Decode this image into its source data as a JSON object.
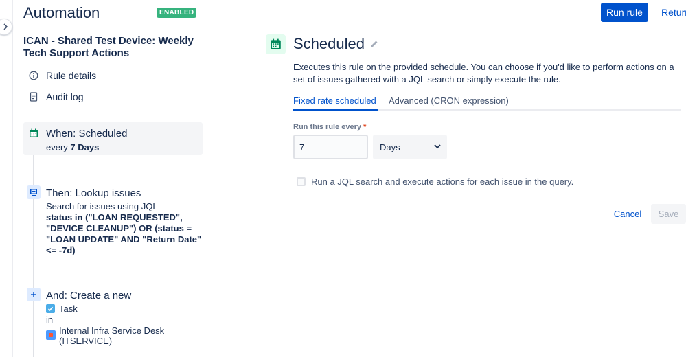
{
  "header": {
    "app_title": "Automation",
    "status": "ENABLED",
    "run_rule_label": "Run rule",
    "return_label": "Return"
  },
  "sidebar": {
    "rule_name": "ICAN - Shared Test Device: Weekly Tech Support Actions",
    "nav": [
      {
        "label": "Rule details",
        "icon": "info-icon"
      },
      {
        "label": "Audit log",
        "icon": "document-icon"
      }
    ],
    "steps": {
      "trigger": {
        "title": "When: Scheduled",
        "sub_prefix": "every ",
        "sub_value": "7 Days",
        "icon": "calendar-icon"
      },
      "lookup": {
        "title": "Then: Lookup issues",
        "sub": "Search for issues using JQL",
        "jql": "status in (\"LOAN REQUESTED\", \"DEVICE CLEANUP\") OR (status = \"LOAN UPDATE\" AND \"Return Date\" <= -7d)",
        "icon": "monitor-icon"
      },
      "create": {
        "title": "And: Create a new",
        "issue_type": "Task",
        "in_label": "in",
        "project": "Internal Infra Service Desk (ITSERVICE)",
        "icon": "plus-icon"
      }
    }
  },
  "main": {
    "title": "Scheduled",
    "description": "Executes this rule on the provided schedule. You can choose if you'd like to perform actions on a set of issues gathered with a JQL search or simply execute the rule.",
    "tabs": [
      {
        "label": "Fixed rate scheduled",
        "active": true
      },
      {
        "label": "Advanced (CRON expression)",
        "active": false
      }
    ],
    "field_label": "Run this rule every",
    "required_marker": "*",
    "interval_value": "7",
    "interval_unit": "Days",
    "jql_checkbox_label": "Run a JQL search and execute actions for each issue in the query.",
    "jql_checkbox_checked": false,
    "cancel_label": "Cancel",
    "save_label": "Save"
  },
  "colors": {
    "primary": "#0052cc",
    "enabled": "#36b37e",
    "calendar_green": "#00875a",
    "text": "#172b4d"
  }
}
